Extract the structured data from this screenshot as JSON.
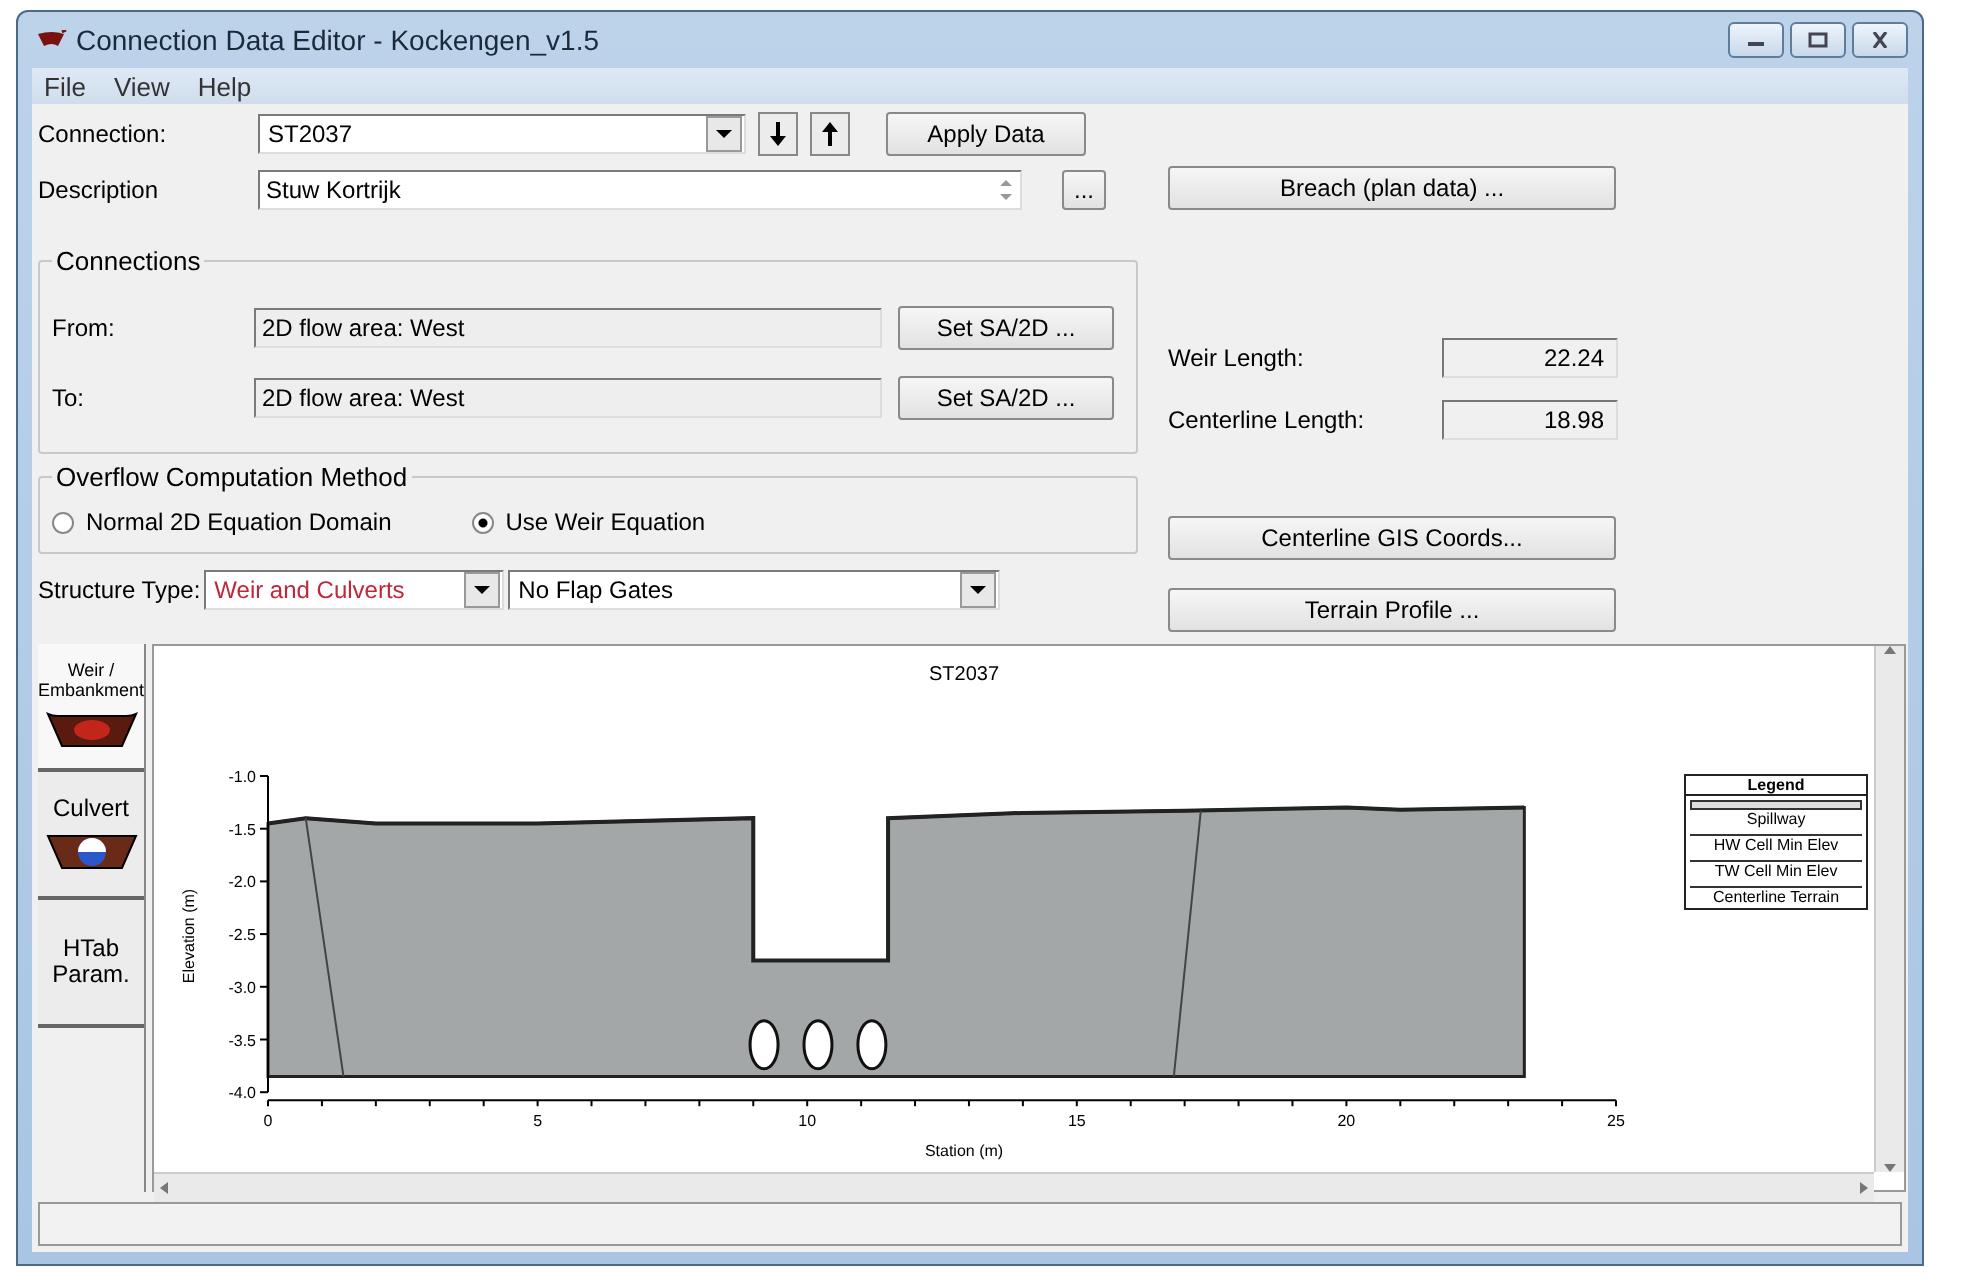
{
  "window": {
    "title": "Connection Data Editor - Kockengen_v1.5"
  },
  "menu": [
    "File",
    "View",
    "Help"
  ],
  "connection": {
    "label": "Connection:",
    "value": "ST2037",
    "apply_button": "Apply Data"
  },
  "description": {
    "label": "Description",
    "value": "Stuw Kortrijk",
    "more_button": "...",
    "breach_button": "Breach (plan data) ..."
  },
  "connections_group": {
    "title": "Connections",
    "rows": [
      {
        "label": "From:",
        "value": "2D flow area: West",
        "button": "Set SA/2D ..."
      },
      {
        "label": "To:",
        "value": "2D flow area: West",
        "button": "Set SA/2D ..."
      }
    ]
  },
  "lengths": [
    {
      "label": "Weir Length:",
      "value": "22.24"
    },
    {
      "label": "Centerline Length:",
      "value": "18.98"
    }
  ],
  "overflow_group": {
    "title": "Overflow Computation Method",
    "options": [
      {
        "label": "Normal 2D Equation Domain",
        "selected": false
      },
      {
        "label": "Use Weir Equation",
        "selected": true
      }
    ]
  },
  "gis_button": "Centerline GIS Coords...",
  "structure": {
    "label": "Structure Type:",
    "type": "Weir and Culverts",
    "gates": "No Flap Gates",
    "terrain_button": "Terrain Profile ..."
  },
  "side_tabs": [
    {
      "label": "Weir / Embankment",
      "kind": "weir",
      "selected": true
    },
    {
      "label": "Culvert",
      "kind": "culvert",
      "selected": false
    },
    {
      "label": "HTab Param.",
      "kind": "text",
      "selected": false
    }
  ],
  "plot": {
    "legend": {
      "title": "Legend",
      "items": [
        "HW Cell Min Elev",
        "TW Cell Min Elev",
        "Centerline Terrain"
      ]
    },
    "chart_data": {
      "type": "line",
      "title": "ST2037",
      "xlabel": "Station (m)",
      "ylabel": "Elevation (m)",
      "x": [
        0,
        0.7,
        2,
        5,
        9,
        9,
        11.5,
        11.5,
        14,
        17,
        20,
        21,
        23.3
      ],
      "series": [
        {
          "name": "Spillway",
          "color": "#222222",
          "values": [
            -1.45,
            -1.4,
            -1.45,
            -1.45,
            -1.4,
            -2.75,
            -2.75,
            -1.4,
            -1.35,
            -1.33,
            -1.3,
            -1.32,
            -1.3
          ]
        }
      ],
      "xlim": [
        0,
        25
      ],
      "ylim": [
        -4,
        -1
      ],
      "xticks": [
        0,
        5,
        10,
        15,
        20,
        25
      ],
      "yticks": [
        {
          "value": -1,
          "label": "-1.0"
        },
        {
          "value": -1.5,
          "label": "-1.5"
        },
        {
          "value": -2,
          "label": "-2.0"
        },
        {
          "value": -2.5,
          "label": "-2.5"
        },
        {
          "value": -3,
          "label": "-3.0"
        },
        {
          "value": -3.5,
          "label": "-3.5"
        },
        {
          "value": -4,
          "label": "-4.0"
        }
      ]
    }
  }
}
